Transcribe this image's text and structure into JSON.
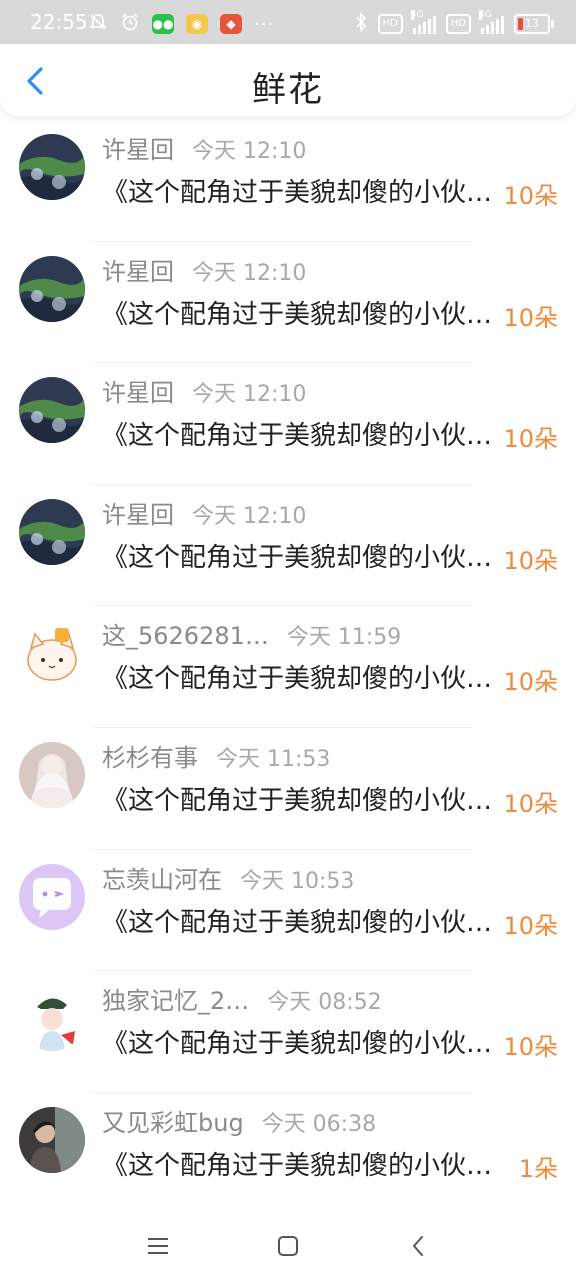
{
  "status_bar": {
    "time": "22:55",
    "network_left": "4G",
    "network_right": "4G",
    "hd_label": "HD",
    "battery": "13",
    "more": "···"
  },
  "header": {
    "title": "鲜花"
  },
  "colors": {
    "accent": "#2f8ef5",
    "count": "#f08a3c"
  },
  "items": [
    {
      "name": "许星回",
      "time": "今天 12:10",
      "message": "《这个配角过于美貌却傻的小伙子》",
      "count": "10朵",
      "avatar": "landscape"
    },
    {
      "name": "许星回",
      "time": "今天 12:10",
      "message": "《这个配角过于美貌却傻的小伙子》",
      "count": "10朵",
      "avatar": "landscape"
    },
    {
      "name": "许星回",
      "time": "今天 12:10",
      "message": "《这个配角过于美貌却傻的小伙子》",
      "count": "10朵",
      "avatar": "landscape"
    },
    {
      "name": "许星回",
      "time": "今天 12:10",
      "message": "《这个配角过于美貌却傻的小伙子》",
      "count": "10朵",
      "avatar": "landscape"
    },
    {
      "name": "这_5626281…",
      "time": "今天 11:59",
      "message": "《这个配角过于美貌却傻的小伙子》",
      "count": "10朵",
      "avatar": "cat"
    },
    {
      "name": "杉杉有事",
      "time": "今天 11:53",
      "message": "《这个配角过于美貌却傻的小伙子》",
      "count": "10朵",
      "avatar": "bride"
    },
    {
      "name": "忘羡山河在",
      "time": "今天 10:53",
      "message": "《这个配角过于美貌却傻的小伙子》",
      "count": "10朵",
      "avatar": "chat-bubble"
    },
    {
      "name": "独家记忆_2…",
      "time": "今天 08:52",
      "message": "《这个配角过于美貌却傻的小伙子》",
      "count": "10朵",
      "avatar": "cartoon-girl"
    },
    {
      "name": "又见彩虹bug",
      "time": "今天 06:38",
      "message": "《这个配角过于美貌却傻的小伙子》",
      "count": "1朵",
      "avatar": "person-photo"
    }
  ]
}
